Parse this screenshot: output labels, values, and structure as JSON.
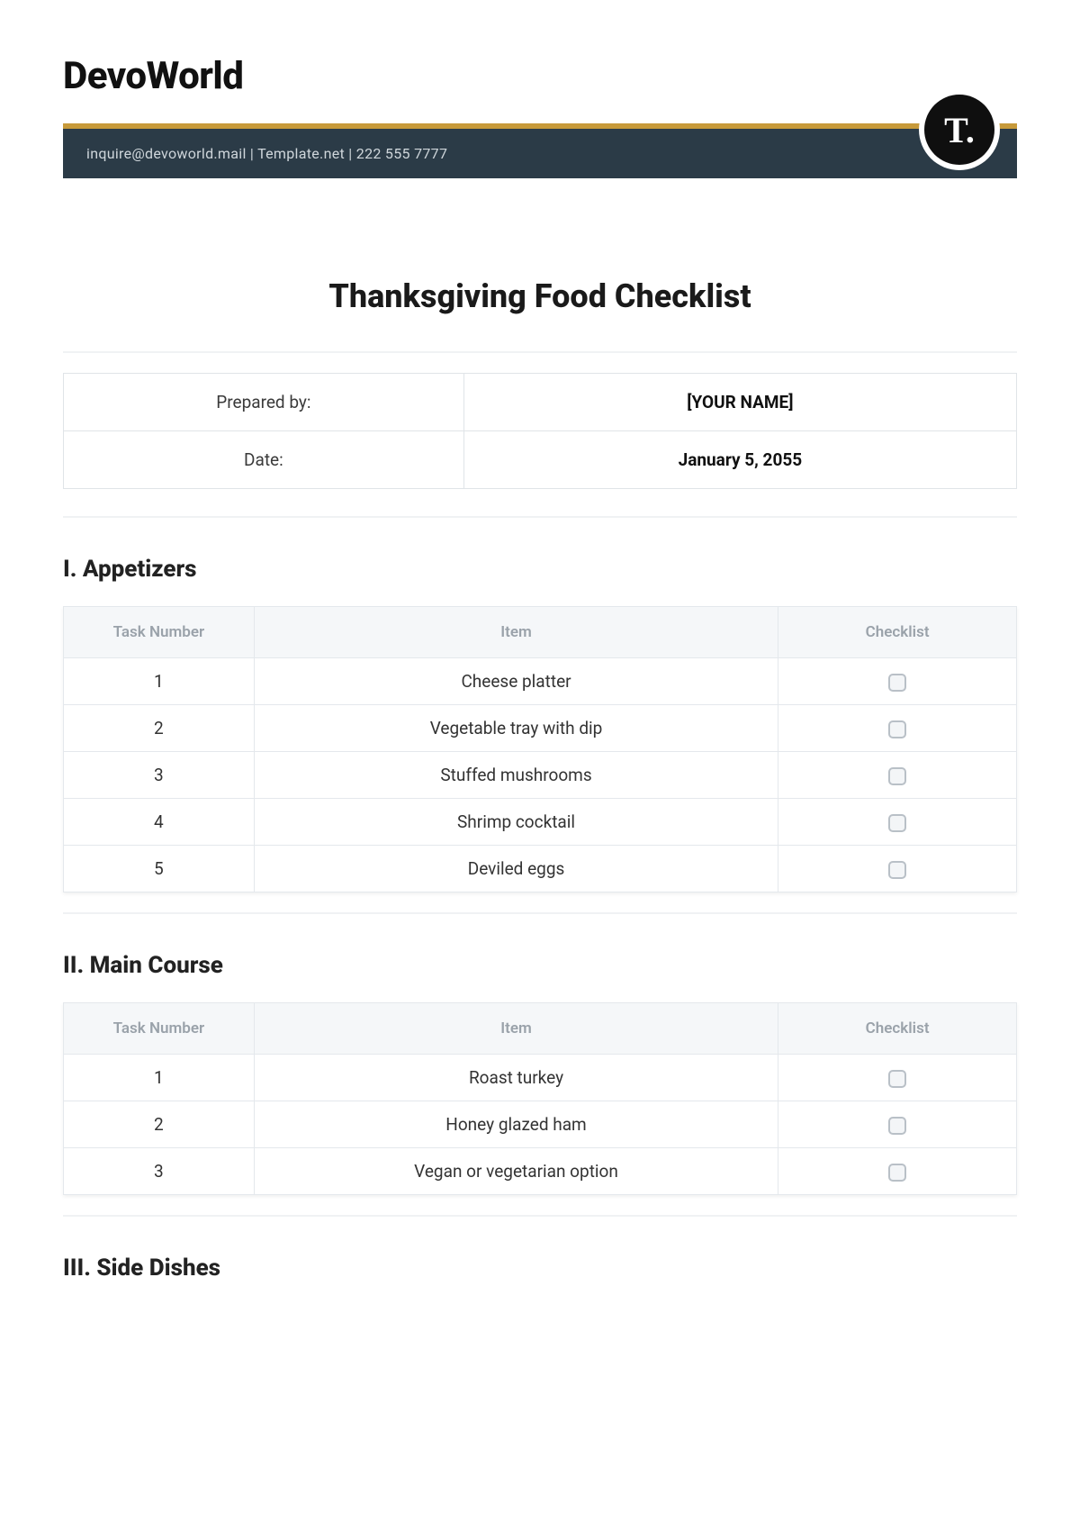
{
  "brand": "DevoWorld",
  "header_contact": "inquire@devoworld.mail | Template.net | 222 555 7777",
  "badge": "T.",
  "title": "Thanksgiving Food Checklist",
  "meta": [
    {
      "label": "Prepared by:",
      "value": "[YOUR NAME]"
    },
    {
      "label": "Date:",
      "value": "January 5, 2055"
    }
  ],
  "columns": {
    "num": "Task Number",
    "item": "Item",
    "check": "Checklist"
  },
  "sections": [
    {
      "heading": "I. Appetizers",
      "rows": [
        {
          "num": "1",
          "item": "Cheese platter"
        },
        {
          "num": "2",
          "item": "Vegetable tray with dip"
        },
        {
          "num": "3",
          "item": "Stuffed mushrooms"
        },
        {
          "num": "4",
          "item": "Shrimp cocktail"
        },
        {
          "num": "5",
          "item": "Deviled eggs"
        }
      ]
    },
    {
      "heading": "II. Main Course",
      "rows": [
        {
          "num": "1",
          "item": "Roast turkey"
        },
        {
          "num": "2",
          "item": "Honey glazed ham"
        },
        {
          "num": "3",
          "item": "Vegan or vegetarian option"
        }
      ]
    },
    {
      "heading": "III. Side Dishes",
      "rows": []
    }
  ]
}
